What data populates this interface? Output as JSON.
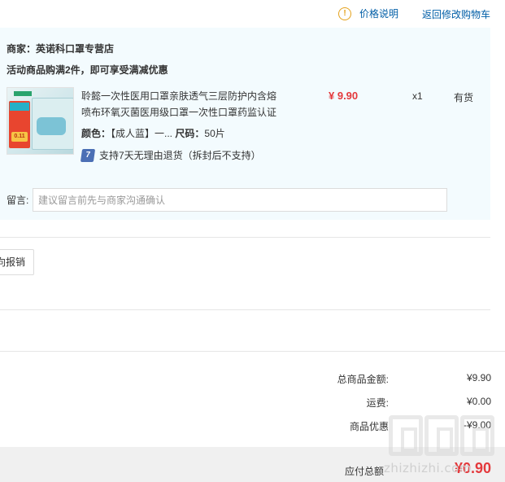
{
  "topbar": {
    "price_help": "价格说明",
    "back_to_cart": "返回修改购物车"
  },
  "shop": {
    "merchant": "商家：英诺科口罩专营店",
    "promo": "活动商品购满2件，即可享受满减优惠"
  },
  "product": {
    "title": "聆懿一次性医用口罩亲肤透气三层防护内含熔喷布环氧灭菌医用级口罩一次性口罩药监认证",
    "color_label": "颜色：",
    "color_value": "【成人蓝】一...",
    "size_label": "尺码：",
    "size_value": "50片",
    "return_icon_text": "7",
    "return_policy": "支持7天无理由退货（拆封后不支持）",
    "price": "¥ 9.90",
    "qty": "x1",
    "stock": "有货",
    "thumb_tag_text": "0.11"
  },
  "note": {
    "label": "留言:",
    "placeholder": "建议留言前先与商家沟通确认"
  },
  "reimburse": {
    "label": "向报销"
  },
  "summary": {
    "goods_total_label": "总商品金额:",
    "goods_total_value": "¥9.90",
    "shipping_label": "运费:",
    "shipping_value": "¥0.00",
    "discount_label": "商品优惠",
    "discount_value": "-¥9.00",
    "payable_label": "应付总额",
    "payable_value": "¥0.90"
  },
  "watermark": {
    "text": "zhizhizhi.com"
  },
  "colors": {
    "link": "#005ea7",
    "price_red": "#e4393c",
    "shop_bg": "#f3fbfe"
  }
}
